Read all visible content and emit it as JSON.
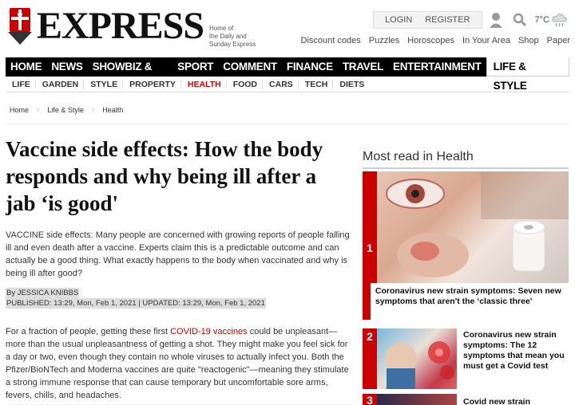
{
  "header": {
    "logo": "EXPRESS",
    "tagline": [
      "Home of",
      "the Daily and",
      "Sunday Express"
    ],
    "login": "LOGIN",
    "register": "REGISTER",
    "temperature": "7°C",
    "util_links": [
      "Discount codes",
      "Puzzles",
      "Horoscopes",
      "In Your Area",
      "Shop",
      "Paper"
    ]
  },
  "nav": {
    "items": [
      "HOME",
      "NEWS",
      "SHOWBIZ & TV",
      "SPORT",
      "COMMENT",
      "FINANCE",
      "TRAVEL",
      "ENTERTAINMENT"
    ],
    "active": "LIFE & STYLE",
    "sub": [
      "LIFE",
      "GARDEN",
      "STYLE",
      "PROPERTY",
      "HEALTH",
      "FOOD",
      "CARS",
      "TECH",
      "DIETS"
    ]
  },
  "breadcrumb": [
    "Home",
    "Life & Style",
    "Health"
  ],
  "article": {
    "headline": "Vaccine side effects: How the body responds and why being ill after a jab ‘is good'",
    "intro": "VACCINE side effects: Many people are concerned with growing reports of people falling ill and even death after a vaccine. Experts claim this is a predictable outcome and can actually be a good thing. What exactly happens to the body when vaccinated and why is being ill after good?",
    "author": "By JESSICA KNIBBS",
    "published": "PUBLISHED: 13:29, Mon, Feb 1, 2021 | UPDATED: 13:29, Mon, Feb 1, 2021",
    "body_pre": "For a fraction of people, getting these first ",
    "body_link": "COVID-19 vaccines",
    "body_post": " could be unpleasant—more than the usual unpleasantness of getting a shot. They might make you feel sick for a day or two, even though they contain no whole viruses to actually infect you. Both the Pfizer/BioNTech and Moderna vaccines are quite \"reactogenic\"—meaning they stimulate a strong immune response that can cause temporary but uncomfortable sore arms, fevers, chills, and headaches."
  },
  "sidebar": {
    "title": "Most read in Health",
    "items": [
      {
        "num": "1",
        "text": "Coronavirus new strain symptoms: Seven new symptoms that aren't the ‘classic three'"
      },
      {
        "num": "2",
        "text": "Coronavirus new strain symptoms: The 12 symptoms that mean you must get a Covid test"
      },
      {
        "num": "3",
        "text": "Covid new strain"
      }
    ]
  },
  "colors": {
    "accent": "#cc0000",
    "nav_bg": "#000000"
  }
}
